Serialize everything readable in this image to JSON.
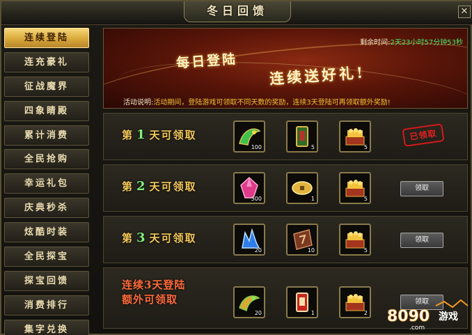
{
  "window": {
    "title": "冬日回馈",
    "close": "✕"
  },
  "sidebar": {
    "items": [
      {
        "label": "连续登陆",
        "active": true
      },
      {
        "label": "连充豪礼"
      },
      {
        "label": "征战魔界"
      },
      {
        "label": "四象睛殿"
      },
      {
        "label": "累计消费"
      },
      {
        "label": "全民抢购"
      },
      {
        "label": "幸运礼包"
      },
      {
        "label": "庆典秒杀"
      },
      {
        "label": "炫酷时装"
      },
      {
        "label": "全民探宝"
      },
      {
        "label": "探宝回馈"
      },
      {
        "label": "消费排行"
      },
      {
        "label": "集字兑换"
      }
    ]
  },
  "banner": {
    "remaining_label": "剩余时间:",
    "remaining_value": "2天23小时57分钟53秒",
    "slogan_1": "每日登陆",
    "slogan_2": "连续送好礼!",
    "desc_label": "活动说明:",
    "desc_text": "活动期间，登陆游戏可领取不同天数的奖励，连续3天登陆可再领取额外奖励!"
  },
  "rows": [
    {
      "prefix": "第",
      "day": "1",
      "suffix": "天可领取",
      "items": [
        {
          "icon": "green-dragon-wing-icon",
          "count": "100"
        },
        {
          "icon": "green-scroll-icon",
          "count": "5"
        },
        {
          "icon": "gold-treasure-chest-icon",
          "count": "5"
        }
      ],
      "status": "claimed",
      "stamp": "已领取"
    },
    {
      "prefix": "第",
      "day": "2",
      "suffix": "天可领取",
      "items": [
        {
          "icon": "pink-crystal-icon",
          "count": "500"
        },
        {
          "icon": "gold-coin-icon",
          "count": "1"
        },
        {
          "icon": "gold-treasure-chest-icon",
          "count": "5"
        }
      ],
      "status": "claim",
      "button": "领取"
    },
    {
      "prefix": "第",
      "day": "3",
      "suffix": "天可领取",
      "items": [
        {
          "icon": "blue-crystal-icon",
          "count": "20"
        },
        {
          "icon": "brown-rune-stone-icon",
          "count": "10"
        },
        {
          "icon": "gold-treasure-chest-icon",
          "count": "5"
        }
      ],
      "status": "claim",
      "button": "领取"
    },
    {
      "label_line1": "连续3天登陆",
      "label_line2": "额外可领取",
      "items": [
        {
          "icon": "golden-wing-icon",
          "count": "20"
        },
        {
          "icon": "red-scroll-icon",
          "count": "1"
        },
        {
          "icon": "gold-treasure-chest-icon",
          "count": "2"
        }
      ],
      "status": "claim",
      "button": "领取"
    }
  ],
  "watermark": {
    "logo_text": "8090",
    "site_text": "游戏",
    "domain": ".com"
  },
  "colors": {
    "gold": "#f3c85a",
    "green_day": "#7ff07a",
    "red_stamp": "#d11a1a",
    "timer_green": "#48e46a"
  }
}
